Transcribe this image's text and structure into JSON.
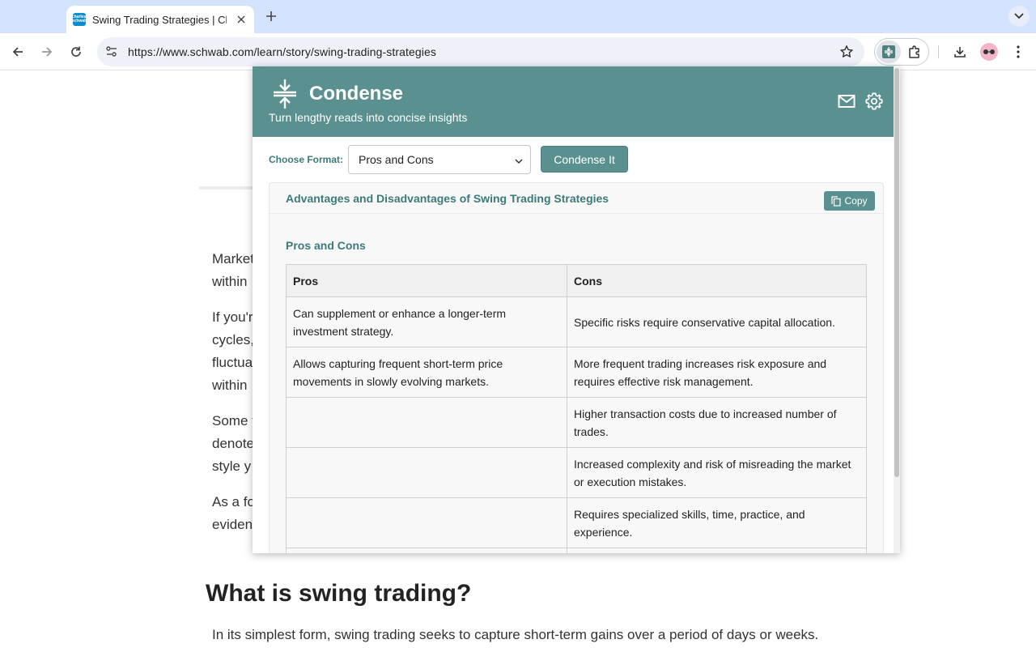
{
  "browser": {
    "tab": {
      "title": "Swing Trading Strategies | Charles Schwab",
      "favicon_text": "charles schwab"
    },
    "url": "https://www.schwab.com/learn/story/swing-trading-strategies"
  },
  "page": {
    "paragraph_fragments": [
      {
        "lines": [
          "Market",
          "within"
        ]
      },
      {
        "lines": [
          "If you'r",
          "cycles,",
          "fluctua",
          "within"
        ]
      },
      {
        "lines": [
          "Some t",
          "denote",
          "style y"
        ]
      },
      {
        "lines": [
          "As a fo",
          "eviden"
        ]
      }
    ],
    "heading": "What is swing trading?",
    "intro": "In its simplest form, swing trading seeks to capture short-term gains over a period of days or weeks."
  },
  "extension": {
    "name": "Condense",
    "tagline": "Turn lengthy reads into concise insights",
    "format_label": "Choose Format:",
    "format_selected": "Pros and Cons",
    "condense_button": "Condense It",
    "result": {
      "title": "Advantages and Disadvantages of Swing Trading Strategies",
      "copy_button": "Copy",
      "section_title": "Pros and Cons",
      "table": {
        "headers": [
          "Pros",
          "Cons"
        ],
        "rows": [
          [
            "Can supplement or enhance a longer-term investment strategy.",
            "Specific risks require conservative capital allocation."
          ],
          [
            "Allows capturing frequent short-term price movements in slowly evolving markets.",
            "More frequent trading increases risk exposure and requires effective risk management."
          ],
          [
            "",
            "Higher transaction costs due to increased number of trades."
          ],
          [
            "",
            "Increased complexity and risk of misreading the market or execution mistakes."
          ],
          [
            "",
            "Requires specialized skills, time, practice, and experience."
          ],
          [
            "",
            ""
          ]
        ]
      }
    }
  },
  "colors": {
    "accent": "#5a9190",
    "accent_text": "#3c7a7a",
    "tabbar": "#d3e3fd"
  }
}
